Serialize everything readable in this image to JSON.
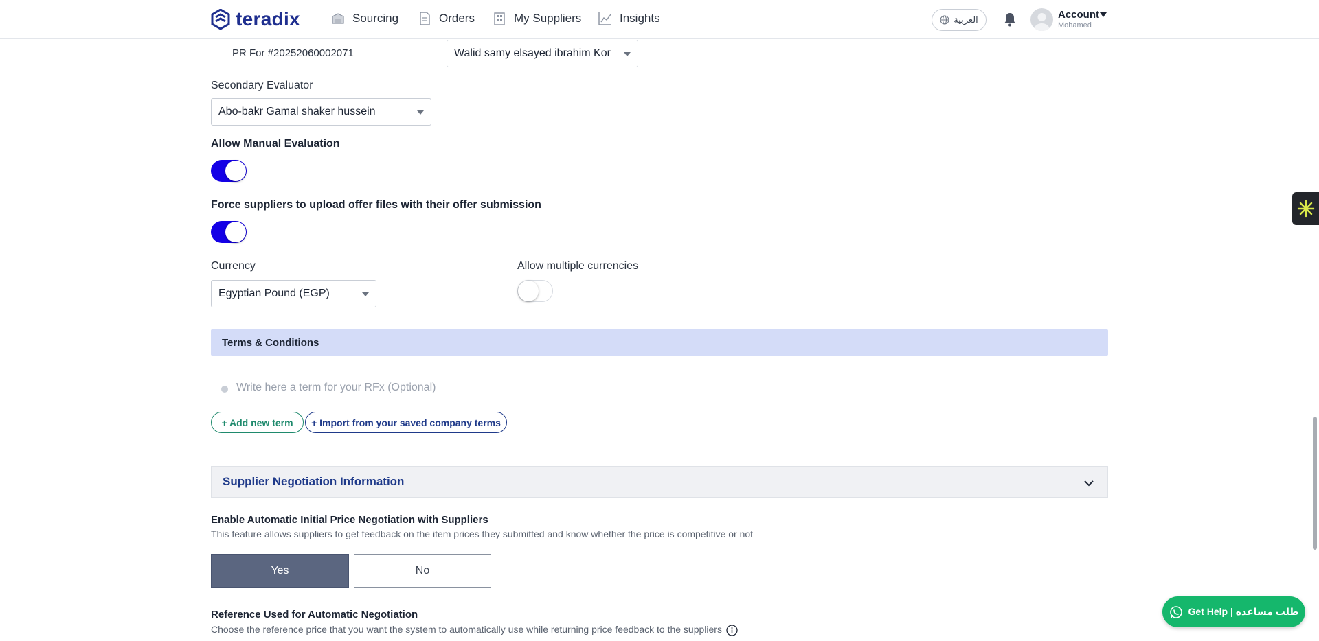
{
  "nav": {
    "logo_text": "teradix",
    "items": [
      {
        "label": "Sourcing",
        "icon": "sourcing-icon"
      },
      {
        "label": "Orders",
        "icon": "orders-icon"
      },
      {
        "label": "My Suppliers",
        "icon": "suppliers-icon"
      },
      {
        "label": "Insights",
        "icon": "insights-icon"
      }
    ],
    "language_label": "العربية",
    "account_label": "Account",
    "account_user": "Mohamed"
  },
  "form": {
    "pr_label": "PR For #20252060002071",
    "pr_evaluator_value": "Walid samy elsayed ibrahim Kor",
    "secondary_evaluator_label": "Secondary Evaluator",
    "secondary_evaluator_value": "Abo-bakr Gamal shaker hussein",
    "allow_manual_label": "Allow Manual Evaluation",
    "allow_manual_on": true,
    "force_upload_label": "Force suppliers to upload offer files with their offer submission",
    "force_upload_on": true,
    "currency_label": "Currency",
    "currency_value": "Egyptian Pound (EGP)",
    "multi_currency_label": "Allow multiple currencies",
    "multi_currency_on": false
  },
  "terms": {
    "section_title": "Terms & Conditions",
    "term_placeholder": "Write here a term for your RFx (Optional)",
    "add_term_label": "+ Add new term",
    "import_terms_label": "+ Import from your saved company terms"
  },
  "negotiation": {
    "section_title": "Supplier Negotiation Information",
    "auto_label": "Enable Automatic Initial Price Negotiation with Suppliers",
    "auto_desc": "This feature allows suppliers to get feedback on the item prices they submitted and know whether the price is competitive or not",
    "yes_label": "Yes",
    "no_label": "No",
    "selected": "Yes",
    "reference_label": "Reference Used for Automatic Negotiation",
    "reference_desc": "Choose the reference price that you want the system to automatically use while returning price feedback to the suppliers"
  },
  "help": {
    "label": "Get Help | طلب مساعده"
  },
  "colors": {
    "brand": "#1f2f8f",
    "toggle_on": "#1400e6",
    "section_bar": "#d4dcf8",
    "help_green": "#15b76c"
  }
}
